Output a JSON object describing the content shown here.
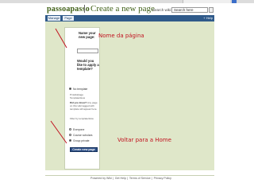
{
  "header": {
    "logo": "passoapasso",
    "page_title": "Create a new page",
    "search_label": "Search wiki:",
    "search_value": "Search here"
  },
  "tabs": [
    {
      "label": "Manage"
    },
    {
      "label": "Page"
    }
  ],
  "help_link": "Help",
  "form": {
    "name_question": "Name your new page:",
    "template_question": "Would you like to apply a template?",
    "radio_no_template": "No template",
    "pmwiki_text": "Pmwiki/page Template/How",
    "did_you_know_title": "Did you know?",
    "did_you_know_text": "Any page on this wiki tagged with template will appear here.",
    "filter_text": "Filter by template/How",
    "perm_options": [
      {
        "label": "Everyone",
        "selected": false
      },
      {
        "label": "Course scholars",
        "selected": false
      },
      {
        "label": "Group private",
        "selected": true
      }
    ],
    "create_button": "Create new page"
  },
  "annotations": {
    "page_name": "Nome da página",
    "back_home": "Voltar para a Home"
  },
  "footer": {
    "links": [
      "Powered by Wiki",
      "Get Help",
      "Terms of Service",
      "Privacy Policy"
    ]
  },
  "colors": {
    "annotation_red": "#c1121f",
    "logo_green": "#3f5f16",
    "nav_blue": "#2f5a8a",
    "content_bg": "#dfe7c9"
  }
}
